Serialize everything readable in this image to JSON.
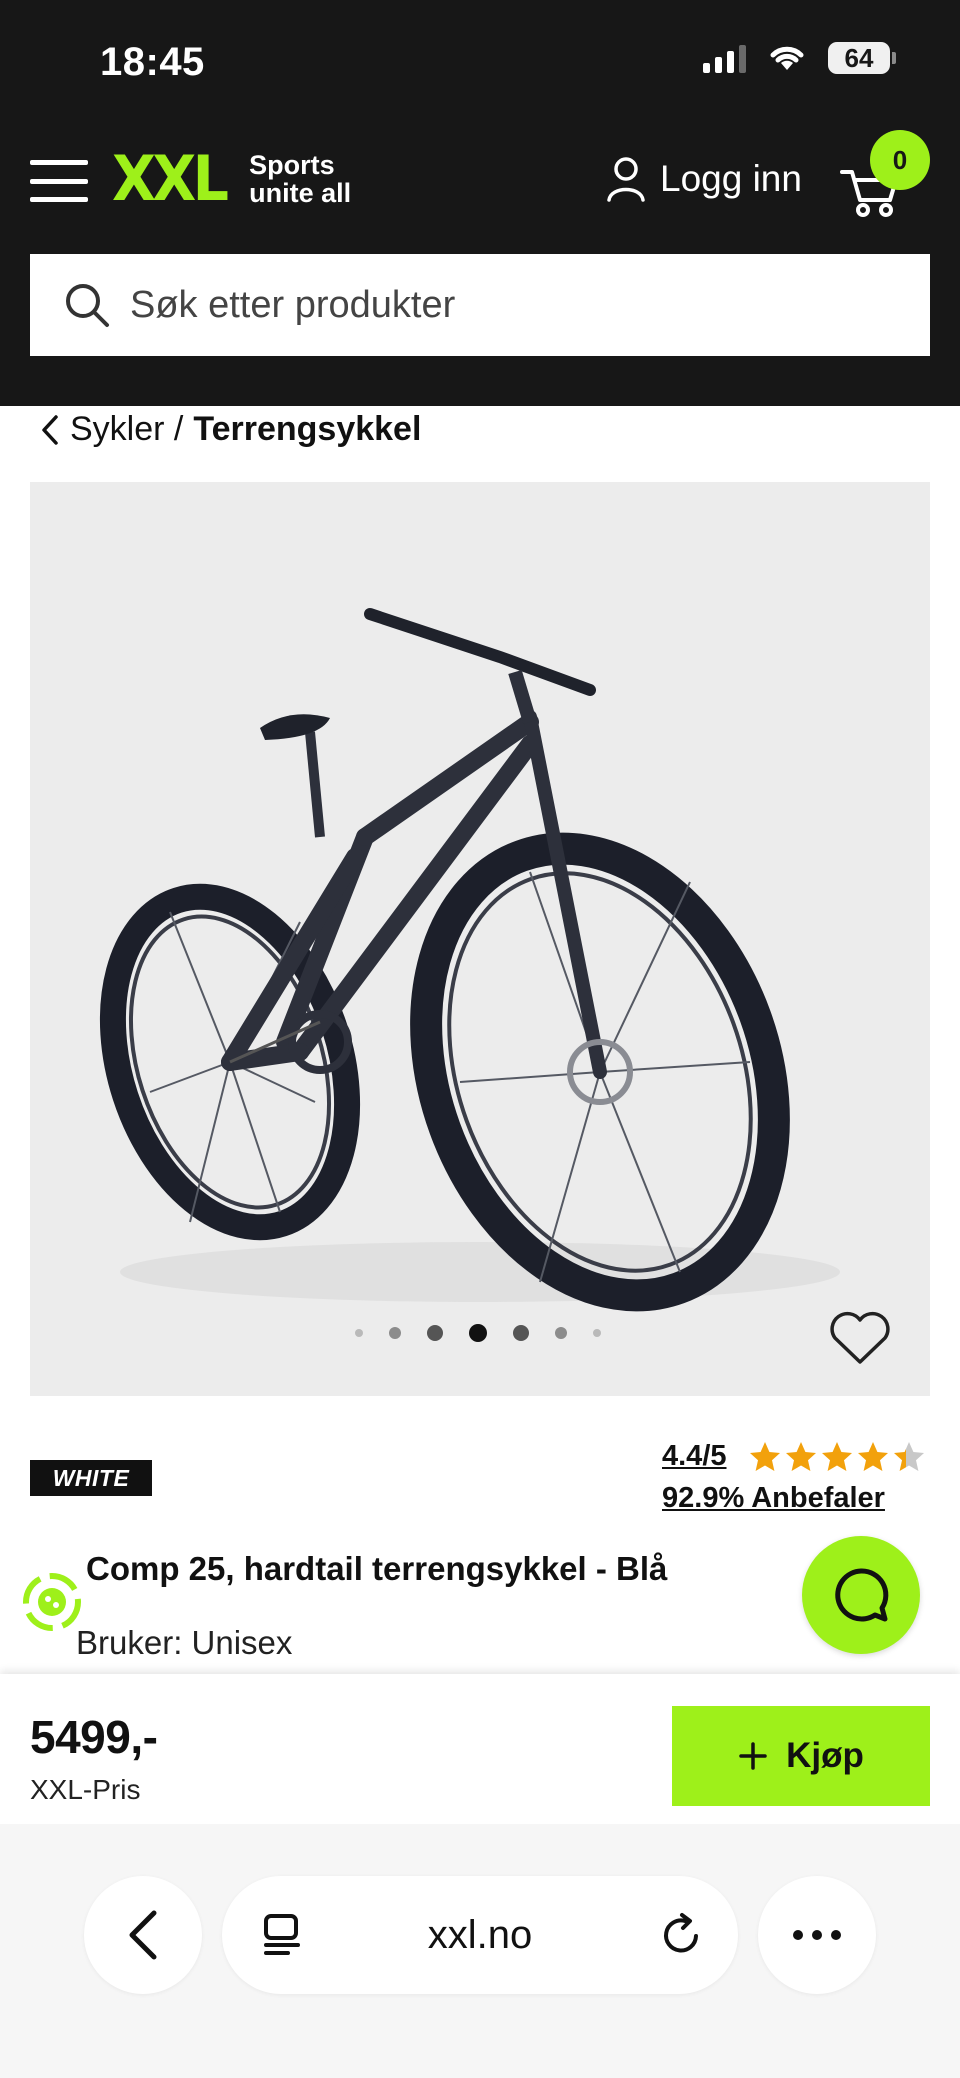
{
  "status": {
    "time": "18:45",
    "battery": "64"
  },
  "header": {
    "logo_text": "XXL",
    "tagline_line1": "Sports",
    "tagline_line2": "unite all",
    "login_label": "Logg inn",
    "cart_count": "0",
    "brand_color": "#9ef01a"
  },
  "search": {
    "placeholder": "Søk etter produkter"
  },
  "breadcrumb": {
    "parent": "Sykler /",
    "current": "Terrengsykkel"
  },
  "gallery": {
    "dot_count": 7,
    "active_index": 3
  },
  "product": {
    "brand": "WHITE",
    "rating": "4.4/5",
    "rating_value": 4.4,
    "recommend": "92.9% Anbefaler",
    "title": "Comp 25, hardtail terrengsykkel - Blå",
    "user": "Bruker: Unisex",
    "price": "5499,-",
    "price_label": "XXL-Pris",
    "buy_label": "Kjøp"
  },
  "browser": {
    "url": "xxl.no"
  }
}
